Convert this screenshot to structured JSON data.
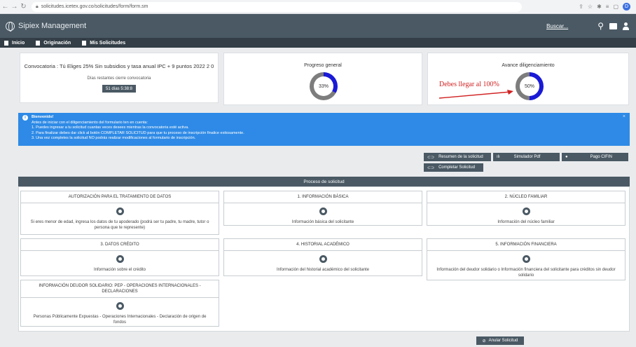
{
  "browser": {
    "url": "solicitudes.icetex.gov.co/solicitudes/form/form.sm",
    "profile_initial": "D"
  },
  "header": {
    "app_name": "Sipiex Management",
    "search_label": "Buscar..."
  },
  "nav": {
    "items": [
      {
        "label": "Inicio"
      },
      {
        "label": "Originación"
      },
      {
        "label": "Mis Solicitudes"
      }
    ]
  },
  "convocatoria": {
    "title": "Convocatoria : Tú Eliges 25% Sin subsidios y tasa anual IPC + 9 puntos 2022 2 0",
    "days_label": "Días restantes cierre convocatoria",
    "days_value": "51 días 5:38:8"
  },
  "progreso": {
    "title": "Progreso general",
    "value_text": "33%",
    "value": 33
  },
  "avance": {
    "title": "Avance diligenciamiento",
    "value_text": "50%",
    "value": 50,
    "annotation": "Debes llegar al 100%"
  },
  "alert": {
    "title": "Bienvenido!",
    "intro": "Antes de iniciar con el diligenciamiento del formulario ten en cuenta:",
    "lines": [
      "1. Puedes ingresar a tu solicitud cuantas veces desees mientras la convocatoria esté activa.",
      "2. Para finalizar debes dar click al botón COMPLETAR SOLICITUD para que tu proceso de inscripción finalice exitosamente.",
      "3. Una vez completes la solicitud NO podrás realizar modificaciones al formulario de inscripción."
    ],
    "close": "×"
  },
  "actions": {
    "resumen": "Resumen de la solicitud",
    "simulador": "Simulador Pdf",
    "pago": "Pago CIFIN",
    "completar": "Completar Solicitud",
    "anular": "Anular Solicitud"
  },
  "proceso": {
    "title": "Proceso de solicitud",
    "cards": [
      {
        "title": "AUTORIZACIÓN PARA EL TRATAMIENTO DE DATOS",
        "desc": "Si eres menor de edad, ingresa los datos de tu apoderado (podrá ser tu padre, tu madre, tutor o persona que te represente)"
      },
      {
        "title": "1. INFORMACIÓN BÁSICA",
        "desc": "Información básica del solicitante"
      },
      {
        "title": "2. NÚCLEO FAMILIAR",
        "desc": "Información del núcleo familiar"
      },
      {
        "title": "3. DATOS CRÉDITO",
        "desc": "Información sobre el crédito"
      },
      {
        "title": "4. HISTORIAL ACADÉMICO",
        "desc": "Información del historial académico del solicitante"
      },
      {
        "title": "5. INFORMACIÓN FINANCIERA",
        "desc": "Información del deudor solidario o Información financiera del solicitante para créditos sin deudor solidario"
      },
      {
        "title": "INFORMACIÓN DEUDOR SOLIDARIO: PEP - OPERACIONES INTERNACIONALES - DECLARACIONES",
        "desc": "Personas Públicamente Expuestas - Operaciones Internacionales - Declaración de origen de fondos"
      }
    ]
  },
  "colors": {
    "header": "#4a5964",
    "nav": "#333e46",
    "alert": "#2e8ae6",
    "donut_fill": "#1a1ad6",
    "donut_rest": "#7d7d7d",
    "annotation": "#d12121"
  }
}
